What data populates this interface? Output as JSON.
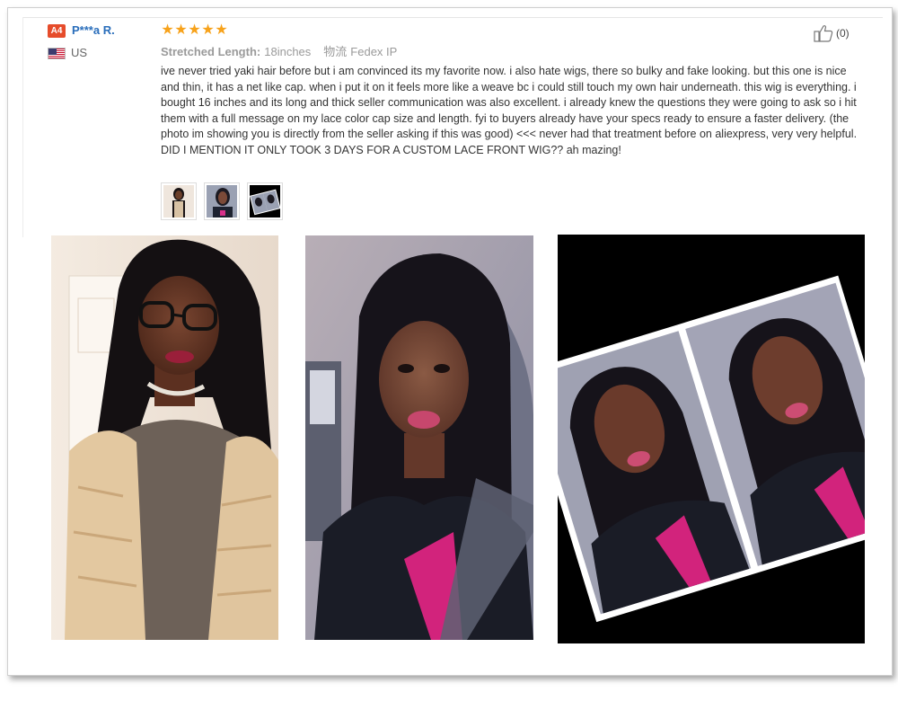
{
  "review": {
    "level_badge": "A4",
    "username": "P***a R.",
    "country": "US",
    "rating_stars": [
      "★",
      "★",
      "★",
      "★",
      "★"
    ],
    "rating_value": 5,
    "attr_label": "Stretched Length:",
    "attr_value": "18inches",
    "logistics_label": "物流",
    "logistics_value": "Fedex IP",
    "helpful_count": "(0)",
    "text": "ive never tried yaki hair before but i am convinced its my favorite now. i also hate wigs, there so bulky and fake looking. but this one is nice and thin, it has a net like cap. when i put it on it feels more like a weave bc i could still touch my own hair underneath. this wig is everything. i bought 16 inches and its long and thick seller communication was also excellent. i already knew the questions they were going to ask so i hit them with a full message on my lace color cap size and length. fyi to buyers already have your specs ready to ensure a faster delivery. (the photo im showing you is directly from the seller asking if this was good) <<< never had that treatment before on aliexpress, very very helpful. DID I MENTION IT ONLY TOOK 3 DAYS FOR A CUSTOM LACE FRONT WIG?? ah mazing!"
  },
  "icons": {
    "badge": "level-badge",
    "flag": "us-flag-icon",
    "star": "star-icon",
    "thumb": "thumbs-up-icon"
  },
  "colors": {
    "star": "#f7a21b",
    "badge": "#e64c2b",
    "username": "#2a6ebb"
  }
}
